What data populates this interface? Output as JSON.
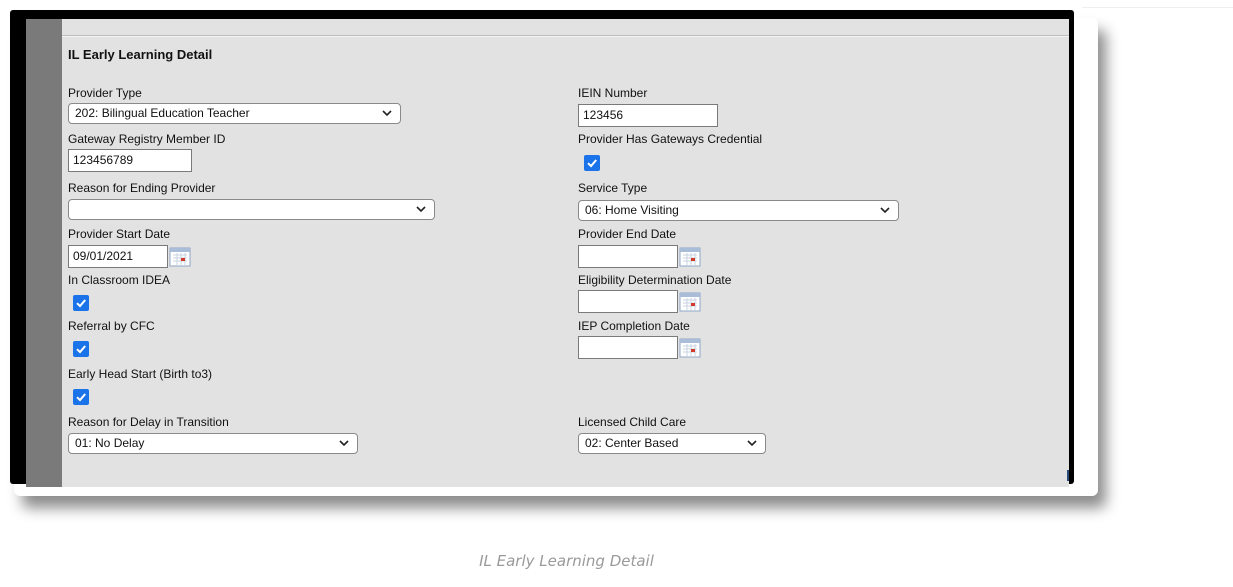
{
  "section": {
    "title": "IL Early Learning Detail"
  },
  "fields": {
    "provider_type": {
      "label": "Provider Type",
      "value": "202: Bilingual Education Teacher"
    },
    "iein_number": {
      "label": "IEIN Number",
      "value": "123456"
    },
    "gateway_registry": {
      "label": "Gateway Registry Member ID",
      "value": "123456789"
    },
    "gateways_credential": {
      "label": "Provider Has Gateways Credential",
      "checked": true
    },
    "reason_ending": {
      "label": "Reason for Ending Provider",
      "value": ""
    },
    "service_type": {
      "label": "Service Type",
      "value": "06: Home Visiting"
    },
    "provider_start_date": {
      "label": "Provider Start Date",
      "value": "09/01/2021"
    },
    "provider_end_date": {
      "label": "Provider End Date",
      "value": ""
    },
    "in_classroom_idea": {
      "label": "In Classroom IDEA",
      "checked": true
    },
    "eligibility_date": {
      "label": "Eligibility Determination Date",
      "value": ""
    },
    "referral_cfc": {
      "label": "Referral by CFC",
      "checked": true
    },
    "iep_completion_date": {
      "label": "IEP Completion Date",
      "value": ""
    },
    "early_head_start": {
      "label": "Early Head Start (Birth to3)",
      "checked": true
    },
    "reason_delay": {
      "label": "Reason for Delay in Transition",
      "value": "01: No Delay"
    },
    "licensed_child_care": {
      "label": "Licensed Child Care",
      "value": "02: Center Based"
    }
  },
  "icons": {
    "dropdown": "chevron-down-icon",
    "calendar": "calendar-icon",
    "checkbox": "checkmark-icon"
  },
  "colors": {
    "panel_background": "#e2e2e2",
    "left_bar": "#7a7a7a",
    "checkbox_accent": "#1a73e8",
    "frame": "#000000"
  },
  "caption": "IL Early Learning Detail"
}
